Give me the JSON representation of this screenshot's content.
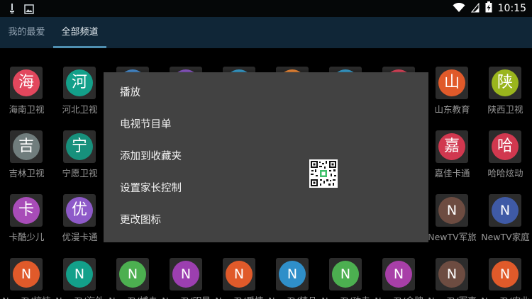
{
  "status_bar": {
    "time": "10:15",
    "left_icons": [
      "usb-debug-icon",
      "image-icon"
    ],
    "right_icons": [
      "wifi-icon",
      "signal-icon",
      "battery-charging-icon"
    ]
  },
  "tabs": [
    {
      "label": "我的最爱",
      "active": false
    },
    {
      "label": "全部频道",
      "active": true
    }
  ],
  "channels": [
    [
      {
        "glyph": "海",
        "name": "海南卫视",
        "color": "#e2475d"
      },
      {
        "glyph": "河",
        "name": "河北卫视",
        "color": "#13a08a"
      },
      {
        "glyph": "",
        "name": "",
        "color": "#4a8fd3"
      },
      {
        "glyph": "",
        "name": "",
        "color": "#8e5ac9"
      },
      {
        "glyph": "",
        "name": "",
        "color": "#3aa0d0"
      },
      {
        "glyph": "",
        "name": "",
        "color": "#f08b3a"
      },
      {
        "glyph": "",
        "name": "",
        "color": "#3aa0d0"
      },
      {
        "glyph": "",
        "name": "",
        "color": "#e2475d"
      },
      {
        "glyph": "山",
        "name": "山东教育",
        "color": "#e05a2a"
      },
      {
        "glyph": "陕",
        "name": "陕西卫视",
        "color": "#9ab51d"
      }
    ],
    [
      {
        "glyph": "吉",
        "name": "吉林卫视",
        "color": "#707d7d"
      },
      {
        "glyph": "宁",
        "name": "宁愿卫视",
        "color": "#17907c"
      },
      {
        "glyph": "",
        "name": "",
        "color": ""
      },
      {
        "glyph": "",
        "name": "",
        "color": ""
      },
      {
        "glyph": "",
        "name": "",
        "color": ""
      },
      {
        "glyph": "",
        "name": "",
        "color": ""
      },
      {
        "glyph": "",
        "name": "",
        "color": ""
      },
      {
        "glyph": "",
        "name": "",
        "color": ""
      },
      {
        "glyph": "嘉",
        "name": "嘉佳卡通",
        "color": "#d1384f"
      },
      {
        "glyph": "哈",
        "name": "哈哈炫动",
        "color": "#d1384f"
      }
    ],
    [
      {
        "glyph": "卡",
        "name": "卡酷少儿",
        "color": "#a84cb8"
      },
      {
        "glyph": "优",
        "name": "优漫卡通",
        "color": "#8e5ac9"
      },
      {
        "glyph": "",
        "name": "",
        "color": ""
      },
      {
        "glyph": "",
        "name": "",
        "color": ""
      },
      {
        "glyph": "",
        "name": "",
        "color": ""
      },
      {
        "glyph": "",
        "name": "",
        "color": ""
      },
      {
        "glyph": "",
        "name": "",
        "color": ""
      },
      {
        "glyph": "",
        "name": "",
        "color": ""
      },
      {
        "glyph": "N",
        "name": "NewTV军旅",
        "color": "#6d4c41"
      },
      {
        "glyph": "N",
        "name": "NewTV家庭",
        "color": "#3f5aa6"
      }
    ],
    [
      {
        "glyph": "N",
        "name": "NewTV惊悚",
        "color": "#e05a2a"
      },
      {
        "glyph": "N",
        "name": "NewTV海外",
        "color": "#13a08a"
      },
      {
        "glyph": "N",
        "name": "NewTV搏击",
        "color": "#4caf50"
      },
      {
        "glyph": "N",
        "name": "NewTV明星",
        "color": "#9c3fb0"
      },
      {
        "glyph": "N",
        "name": "NewTV爱情",
        "color": "#e05a2a"
      },
      {
        "glyph": "N",
        "name": "NewTV精品",
        "color": "#2f8fc9"
      },
      {
        "glyph": "N",
        "name": "NewTV功夫",
        "color": "#4caf50"
      },
      {
        "glyph": "N",
        "name": "NewTV金牌",
        "color": "#a83fa8"
      },
      {
        "glyph": "N",
        "name": "NewTV军事",
        "color": "#6d4c41"
      },
      {
        "glyph": "N",
        "name": "NewTV农业",
        "color": "#e05a2a"
      }
    ]
  ],
  "context_menu": {
    "items": [
      "播放",
      "电视节目单",
      "添加到收藏夹",
      "设置家长控制",
      "更改图标"
    ]
  },
  "colors": {
    "status_bar_bg": "#050708",
    "tab_bar_bg": "#102637",
    "tab_indicator": "#4f8fb1",
    "dialog_bg": "#424242",
    "tile_bg": "#2c2c2c"
  }
}
